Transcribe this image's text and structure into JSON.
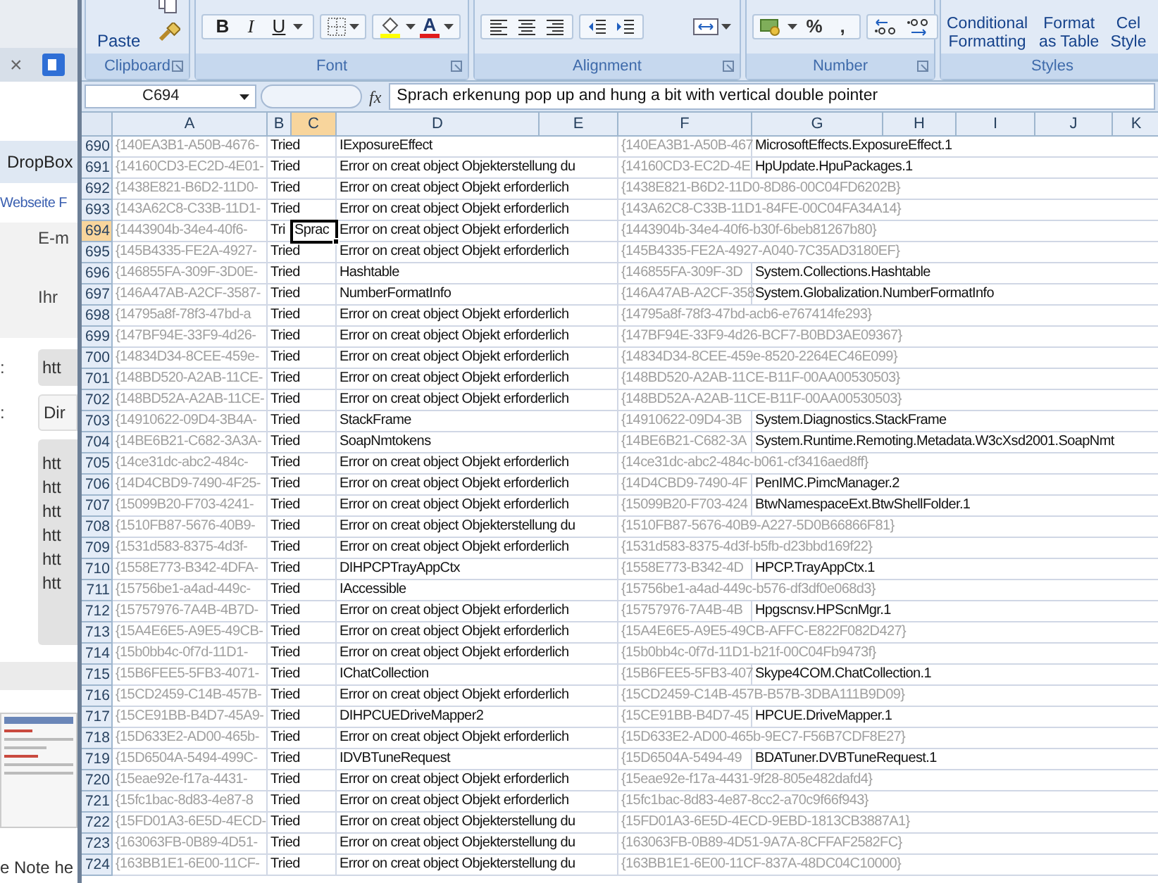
{
  "browser": {
    "tab_close": "×",
    "bookmark": "DropBox",
    "link": "Webseite F",
    "labels": [
      "E-m",
      "Ihr"
    ],
    "fields": [
      {
        "label": ":",
        "value": "htt"
      },
      {
        "label": ":",
        "value": "Dir"
      }
    ],
    "text_area_lines": [
      "htt",
      "htt",
      "htt",
      "htt",
      "htt",
      "htt"
    ],
    "note": "e Note he"
  },
  "ribbon": {
    "paste": "Paste",
    "font_buttons": [
      "B",
      "I",
      "U"
    ],
    "font_color": "A",
    "number_buttons": [
      "%",
      ","
    ],
    "styles_buttons": [
      {
        "line1": "Conditional",
        "line2": "Formatting"
      },
      {
        "line1": "Format",
        "line2": "as Table"
      },
      {
        "line1": "Cel",
        "line2": "Style"
      }
    ],
    "groups": [
      {
        "label": "Clipboard"
      },
      {
        "label": "Font"
      },
      {
        "label": "Alignment"
      },
      {
        "label": "Number"
      },
      {
        "label": "Styles"
      }
    ]
  },
  "formula_bar": {
    "name_box": "C694",
    "fx": "fx",
    "formula": "Sprach erkenung pop up and hung a bit with vertical double pointer"
  },
  "columns": [
    {
      "label": "A",
      "selected": false
    },
    {
      "label": "B",
      "selected": false
    },
    {
      "label": "C",
      "selected": true
    },
    {
      "label": "D",
      "selected": false
    },
    {
      "label": "E",
      "selected": false
    },
    {
      "label": "F",
      "selected": false
    },
    {
      "label": "G",
      "selected": false
    },
    {
      "label": "H",
      "selected": false
    },
    {
      "label": "I",
      "selected": false
    },
    {
      "label": "J",
      "selected": false
    },
    {
      "label": "K",
      "selected": false
    }
  ],
  "rows": [
    {
      "number": "690",
      "selected": false,
      "cells": {
        "a": "{140EA3B1-A50B-4676-",
        "b": "Tried",
        "d": "IExposureEffect",
        "f": "{140EA3B1-A50B-467",
        "g": "MicrosoftEffects.ExposureEffect.1"
      }
    },
    {
      "number": "691",
      "selected": false,
      "cells": {
        "a": "{14160CD3-EC2D-4E01-",
        "b": "Tried",
        "d": "Error on creat object Objekterstellung du",
        "f": "{14160CD3-EC2D-4E",
        "g": "HpUpdate.HpuPackages.1"
      }
    },
    {
      "number": "692",
      "selected": false,
      "cells": {
        "a": "{1438E821-B6D2-11D0-",
        "b": "Tried",
        "d": "Error on creat object Objekt erforderlich",
        "f": "{1438E821-B6D2-11D0-8D86-00C04FD6202B}"
      }
    },
    {
      "number": "693",
      "selected": false,
      "cells": {
        "a": "{143A62C8-C33B-11D1-",
        "b": "Tried",
        "d": "Error on creat object Objekt erforderlich",
        "f": "{143A62C8-C33B-11D1-84FE-00C04FA34A14}"
      }
    },
    {
      "number": "694",
      "selected": true,
      "cells": {
        "a": "{1443904b-34e4-40f6-",
        "b": "Tri",
        "c": "Sprac",
        "d": "Error on creat object Objekt erforderlich",
        "f": "{1443904b-34e4-40f6-b30f-6beb81267b80}"
      }
    },
    {
      "number": "695",
      "selected": false,
      "cells": {
        "a": "{145B4335-FE2A-4927-",
        "b": "Tried",
        "d": "Error on creat object Objekt erforderlich",
        "f": "{145B4335-FE2A-4927-A040-7C35AD3180EF}"
      }
    },
    {
      "number": "696",
      "selected": false,
      "cells": {
        "a": "{146855FA-309F-3D0E-",
        "b": "Tried",
        "d": "Hashtable",
        "f": "{146855FA-309F-3D",
        "g": "System.Collections.Hashtable"
      }
    },
    {
      "number": "697",
      "selected": false,
      "cells": {
        "a": "{146A47AB-A2CF-3587-",
        "b": "Tried",
        "d": "NumberFormatInfo",
        "f": "{146A47AB-A2CF-358",
        "g": "System.Globalization.NumberFormatInfo"
      }
    },
    {
      "number": "698",
      "selected": false,
      "cells": {
        "a": "{14795a8f-78f3-47bd-a",
        "b": "Tried",
        "d": "Error on creat object Objekt erforderlich",
        "f": "{14795a8f-78f3-47bd-acb6-e767414fe293}"
      }
    },
    {
      "number": "699",
      "selected": false,
      "cells": {
        "a": "{147BF94E-33F9-4d26-",
        "b": "Tried",
        "d": "Error on creat object Objekt erforderlich",
        "f": "{147BF94E-33F9-4d26-BCF7-B0BD3AE09367}"
      }
    },
    {
      "number": "700",
      "selected": false,
      "cells": {
        "a": "{14834D34-8CEE-459e-",
        "b": "Tried",
        "d": "Error on creat object Objekt erforderlich",
        "f": "{14834D34-8CEE-459e-8520-2264EC46E099}"
      }
    },
    {
      "number": "701",
      "selected": false,
      "cells": {
        "a": "{148BD520-A2AB-11CE-",
        "b": "Tried",
        "d": "Error on creat object Objekt erforderlich",
        "f": "{148BD520-A2AB-11CE-B11F-00AA00530503}"
      }
    },
    {
      "number": "702",
      "selected": false,
      "cells": {
        "a": "{148BD52A-A2AB-11CE-",
        "b": "Tried",
        "d": "Error on creat object Objekt erforderlich",
        "f": "{148BD52A-A2AB-11CE-B11F-00AA00530503}"
      }
    },
    {
      "number": "703",
      "selected": false,
      "cells": {
        "a": "{14910622-09D4-3B4A-",
        "b": "Tried",
        "d": "StackFrame",
        "f": "{14910622-09D4-3B",
        "g": "System.Diagnostics.StackFrame"
      }
    },
    {
      "number": "704",
      "selected": false,
      "cells": {
        "a": "{14BE6B21-C682-3A3A-",
        "b": "Tried",
        "d": "SoapNmtokens",
        "f": "{14BE6B21-C682-3A",
        "g": "System.Runtime.Remoting.Metadata.W3cXsd2001.SoapNmt"
      }
    },
    {
      "number": "705",
      "selected": false,
      "cells": {
        "a": "{14ce31dc-abc2-484c-",
        "b": "Tried",
        "d": "Error on creat object Objekt erforderlich",
        "f": "{14ce31dc-abc2-484c-b061-cf3416aed8ff}"
      }
    },
    {
      "number": "706",
      "selected": false,
      "cells": {
        "a": "{14D4CBD9-7490-4F25-",
        "b": "Tried",
        "d": "Error on creat object Objekt erforderlich",
        "f": "{14D4CBD9-7490-4F",
        "g": "PenIMC.PimcManager.2"
      }
    },
    {
      "number": "707",
      "selected": false,
      "cells": {
        "a": "{15099B20-F703-4241-",
        "b": "Tried",
        "d": "Error on creat object Objekt erforderlich",
        "f": "{15099B20-F703-424",
        "g": "BtwNamespaceExt.BtwShellFolder.1"
      }
    },
    {
      "number": "708",
      "selected": false,
      "cells": {
        "a": "{1510FB87-5676-40B9-",
        "b": "Tried",
        "d": "Error on creat object Objekterstellung du",
        "f": "{1510FB87-5676-40B9-A227-5D0B66866F81}"
      }
    },
    {
      "number": "709",
      "selected": false,
      "cells": {
        "a": "{1531d583-8375-4d3f-",
        "b": "Tried",
        "d": "Error on creat object Objekt erforderlich",
        "f": "{1531d583-8375-4d3f-b5fb-d23bbd169f22}"
      }
    },
    {
      "number": "710",
      "selected": false,
      "cells": {
        "a": "{1558E773-B342-4DFA-",
        "b": "Tried",
        "d": "DIHPCPTrayAppCtx",
        "f": "{1558E773-B342-4D",
        "g": "HPCP.TrayAppCtx.1"
      }
    },
    {
      "number": "711",
      "selected": false,
      "cells": {
        "a": "{15756be1-a4ad-449c-",
        "b": "Tried",
        "d": "IAccessible",
        "f": "{15756be1-a4ad-449c-b576-df3df0e068d3}"
      }
    },
    {
      "number": "712",
      "selected": false,
      "cells": {
        "a": "{15757976-7A4B-4B7D-",
        "b": "Tried",
        "d": "Error on creat object Objekt erforderlich",
        "f": "{15757976-7A4B-4B",
        "g": "Hpgscnsv.HPScnMgr.1"
      }
    },
    {
      "number": "713",
      "selected": false,
      "cells": {
        "a": "{15A4E6E5-A9E5-49CB-",
        "b": "Tried",
        "d": "Error on creat object Objekt erforderlich",
        "f": "{15A4E6E5-A9E5-49CB-AFFC-E822F082D427}"
      }
    },
    {
      "number": "714",
      "selected": false,
      "cells": {
        "a": "{15b0bb4c-0f7d-11D1-",
        "b": "Tried",
        "d": "Error on creat object Objekt erforderlich",
        "f": "{15b0bb4c-0f7d-11D1-b21f-00C04Fb9473f}"
      }
    },
    {
      "number": "715",
      "selected": false,
      "cells": {
        "a": "{15B6FEE5-5FB3-4071-",
        "b": "Tried",
        "d": "IChatCollection",
        "f": "{15B6FEE5-5FB3-407",
        "g": "Skype4COM.ChatCollection.1"
      }
    },
    {
      "number": "716",
      "selected": false,
      "cells": {
        "a": "{15CD2459-C14B-457B-",
        "b": "Tried",
        "d": "Error on creat object Objekt erforderlich",
        "f": "{15CD2459-C14B-457B-B57B-3DBA111B9D09}"
      }
    },
    {
      "number": "717",
      "selected": false,
      "cells": {
        "a": "{15CE91BB-B4D7-45A9-",
        "b": "Tried",
        "d": "DIHPCUEDriveMapper2",
        "f": "{15CE91BB-B4D7-45",
        "g": "HPCUE.DriveMapper.1"
      }
    },
    {
      "number": "718",
      "selected": false,
      "cells": {
        "a": "{15D633E2-AD00-465b-",
        "b": "Tried",
        "d": "Error on creat object Objekt erforderlich",
        "f": "{15D633E2-AD00-465b-9EC7-F56B7CDF8E27}"
      }
    },
    {
      "number": "719",
      "selected": false,
      "cells": {
        "a": "{15D6504A-5494-499C-",
        "b": "Tried",
        "d": "IDVBTuneRequest",
        "f": "{15D6504A-5494-49",
        "g": "BDATuner.DVBTuneRequest.1"
      }
    },
    {
      "number": "720",
      "selected": false,
      "cells": {
        "a": "{15eae92e-f17a-4431-",
        "b": "Tried",
        "d": "Error on creat object Objekt erforderlich",
        "f": "{15eae92e-f17a-4431-9f28-805e482dafd4}"
      }
    },
    {
      "number": "721",
      "selected": false,
      "cells": {
        "a": "{15fc1bac-8d83-4e87-8",
        "b": "Tried",
        "d": "Error on creat object Objekt erforderlich",
        "f": "{15fc1bac-8d83-4e87-8cc2-a70c9f66f943}"
      }
    },
    {
      "number": "722",
      "selected": false,
      "cells": {
        "a": "{15FD01A3-6E5D-4ECD-",
        "b": "Tried",
        "d": "Error on creat object Objekterstellung du",
        "f": "{15FD01A3-6E5D-4ECD-9EBD-1813CB3887A1}"
      }
    },
    {
      "number": "723",
      "selected": false,
      "cells": {
        "a": "{163063FB-0B89-4D51-",
        "b": "Tried",
        "d": "Error on creat object Objekterstellung du",
        "f": "{163063FB-0B89-4D51-9A7A-8CFFAF2582FC}"
      }
    },
    {
      "number": "724",
      "selected": false,
      "cells": {
        "a": "{163BB1E1-6E00-11CF-",
        "b": "Tried",
        "d": "Error on creat object Objekterstellung du",
        "f": "{163BB1E1-6E00-11CF-837A-48DC04C10000}"
      }
    }
  ]
}
